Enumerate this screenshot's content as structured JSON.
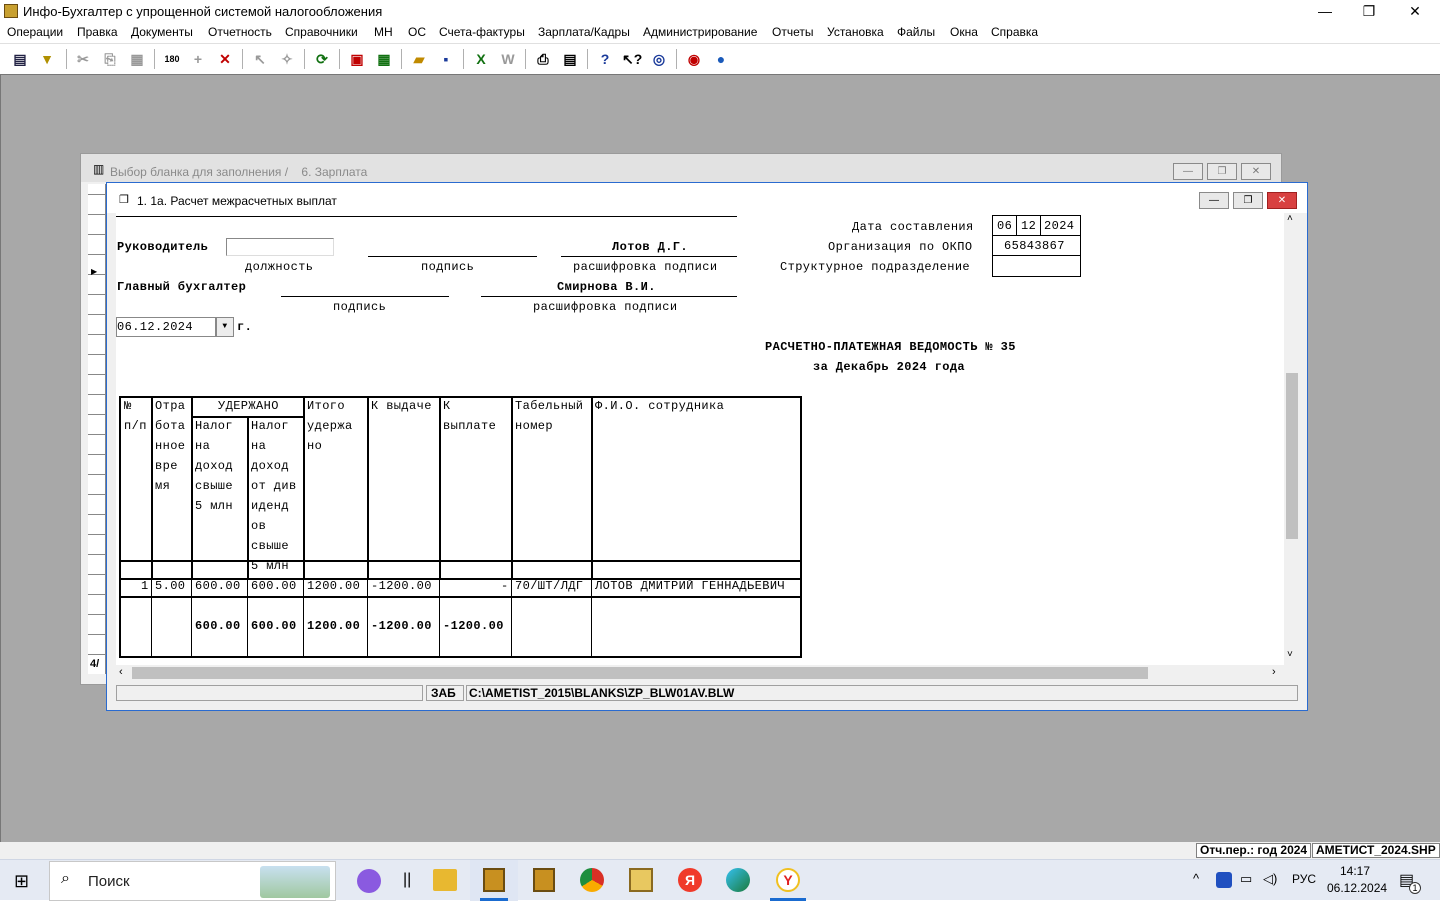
{
  "app": {
    "title": "Инфо-Бухгалтер с упрощенной системой налогообложения"
  },
  "menu": [
    "Операции",
    "Правка",
    "Документы",
    "Отчетность",
    "Справочники",
    "МН",
    "ОС",
    "Счета-фактуры",
    "Зарплата/Кадры",
    "Администрирование",
    "Отчеты",
    "Установка",
    "Файлы",
    "Окна",
    "Справка"
  ],
  "back_window": {
    "title": "Выбор бланка для заполнения /    6. Зарплата",
    "side_label": "4/"
  },
  "front_window": {
    "title": "1. 1а. Расчет межрасчетных выплат"
  },
  "form": {
    "head_label": "Руководитель",
    "head_name": "Лотов Д.Г.",
    "position_caption": "должность",
    "signature_caption": "подпись",
    "decoding_caption": "расшифровка подписи",
    "chief_accountant_label": "Главный бухгалтер",
    "chief_accountant_name": "Смирнова В.И.",
    "date_value": "06.12.2024",
    "date_suffix": "г.",
    "date_label": "Дата составления",
    "date_day": "06",
    "date_month": "12",
    "date_year": "2024",
    "okpo_label": "Организация по ОКПО",
    "okpo_value": "65843867",
    "division_label": "Структурное подразделение",
    "statement_title": "РАСЧЕТНО-ПЛАТЕЖНАЯ ВЕДОМОСТЬ № 35",
    "statement_period": "за Декабрь 2024 года"
  },
  "table": {
    "col_no": [
      "№",
      "п/п"
    ],
    "col_worked": [
      "Отра",
      "бота",
      "нное",
      "вре",
      "мя"
    ],
    "withheld": "УДЕРЖАНО",
    "col_tax1": [
      "Налог",
      "на",
      "доход",
      "свыше",
      "5 млн"
    ],
    "col_tax2": [
      "Налог",
      "на",
      "доход",
      "от див",
      "иденд",
      "ов",
      "свыше",
      "5 млн"
    ],
    "col_total": [
      "Итого",
      "удержа",
      "но"
    ],
    "col_issue": "К выдаче",
    "col_pay": [
      "К",
      "выплате"
    ],
    "col_tab": [
      "Табельный",
      "номер"
    ],
    "col_fio": "Ф.И.О. сотрудника",
    "row": {
      "no": "1",
      "worked": "5.00",
      "tax1": "600.00",
      "tax2": "600.00",
      "total": "1200.00",
      "issue": "-1200.00",
      "pay": "-",
      "tab": "70/ШТ/ЛДГ",
      "fio": "ЛОТОВ ДМИТРИЙ ГЕННАДЬЕВИЧ"
    },
    "totals": {
      "tax1": "600.00",
      "tax2": "600.00",
      "total": "1200.00",
      "issue": "-1200.00",
      "pay": "-1200.00"
    }
  },
  "pathbar": {
    "mode": "ЗАБ",
    "path": "C:\\AMETIST_2015\\BLANKS\\ZP_BLW01AV.BLW"
  },
  "status": {
    "period": "Отч.пер.: год 2024",
    "file": "АМЕТИСТ_2024.SHP"
  },
  "taskbar": {
    "search": "Поиск",
    "lang": "РУС",
    "time": "14:17",
    "date": "06.12.2024",
    "notif_count": "1"
  }
}
